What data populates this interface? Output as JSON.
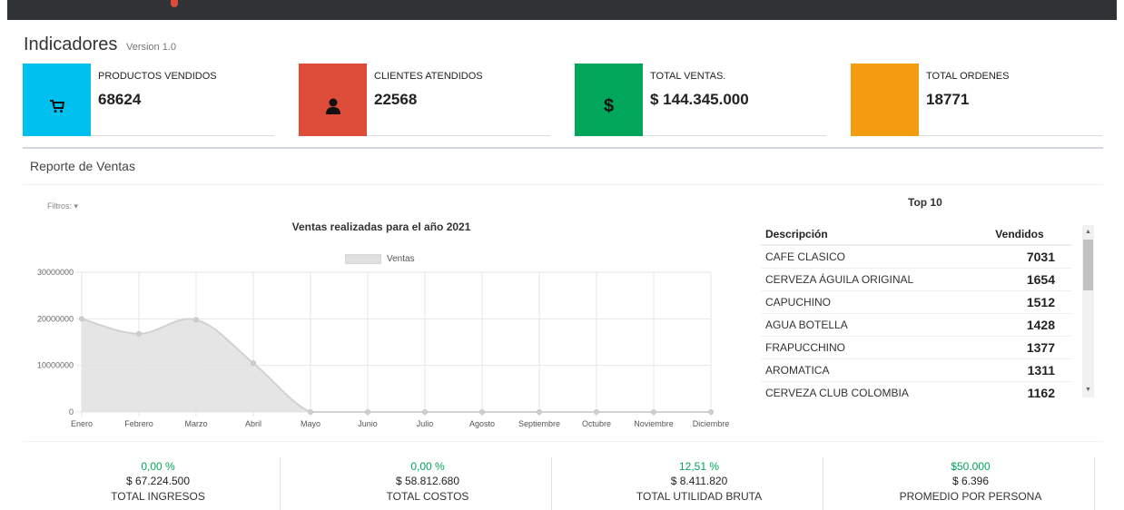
{
  "header": {
    "title": "Indicadores",
    "version": "Version 1.0"
  },
  "info_boxes": [
    {
      "label": "PRODUCTOS VENDIDOS",
      "value": "68624",
      "icon": "cart-icon",
      "color": "#00c0ef"
    },
    {
      "label": "CLIENTES ATENDIDOS",
      "value": "22568",
      "icon": "user-icon",
      "color": "#dd4b39"
    },
    {
      "label": "TOTAL VENTAS.",
      "value": "$ 144.345.000",
      "icon": "dollar-icon",
      "color": "#00a65a"
    },
    {
      "label": "TOTAL ORDENES",
      "value": "18771",
      "icon": "none",
      "color": "#f39c12"
    }
  ],
  "report": {
    "title": "Reporte de Ventas",
    "filter_label": "Filtros:"
  },
  "chart_data": {
    "type": "area",
    "title": "Ventas realizadas para el año 2021",
    "categories": [
      "Enero",
      "Febrero",
      "Marzo",
      "Abril",
      "Mayo",
      "Junio",
      "Julio",
      "Agosto",
      "Septiembre",
      "Octubre",
      "Noviembre",
      "Diciembre"
    ],
    "series": [
      {
        "name": "Ventas",
        "values": [
          20000000,
          16800000,
          19800000,
          10500000,
          0,
          0,
          0,
          0,
          0,
          0,
          0,
          0
        ]
      }
    ],
    "y_ticks": [
      "0",
      "10000000",
      "20000000",
      "30000000"
    ],
    "ylim": [
      0,
      30000000
    ],
    "grid": true,
    "legend_position": "top",
    "fill_color": "#e0e0e0",
    "line_color": "#d2d2d2"
  },
  "top10": {
    "title": "Top 10",
    "headers": [
      "Descripción",
      "Vendidos"
    ],
    "rows": [
      {
        "desc": "CAFE CLASICO",
        "qty": "7031"
      },
      {
        "desc": "CERVEZA ÁGUILA ORIGINAL",
        "qty": "1654"
      },
      {
        "desc": "CAPUCHINO",
        "qty": "1512"
      },
      {
        "desc": "AGUA BOTELLA",
        "qty": "1428"
      },
      {
        "desc": "FRAPUCCHINO",
        "qty": "1377"
      },
      {
        "desc": "AROMATICA",
        "qty": "1311"
      },
      {
        "desc": "CERVEZA CLUB COLOMBIA",
        "qty": "1162"
      }
    ]
  },
  "stats": [
    {
      "pct": "0,00 %",
      "amount": "$ 67.224.500",
      "label": "TOTAL INGRESOS"
    },
    {
      "pct": "0,00 %",
      "amount": "$ 58.812.680",
      "label": "TOTAL COSTOS"
    },
    {
      "pct": "12,51 %",
      "amount": "$ 8.411.820",
      "label": "TOTAL UTILIDAD BRUTA"
    },
    {
      "pct": "$50.000",
      "amount": "$ 6.396",
      "label": "PROMEDIO POR PERSONA"
    }
  ]
}
